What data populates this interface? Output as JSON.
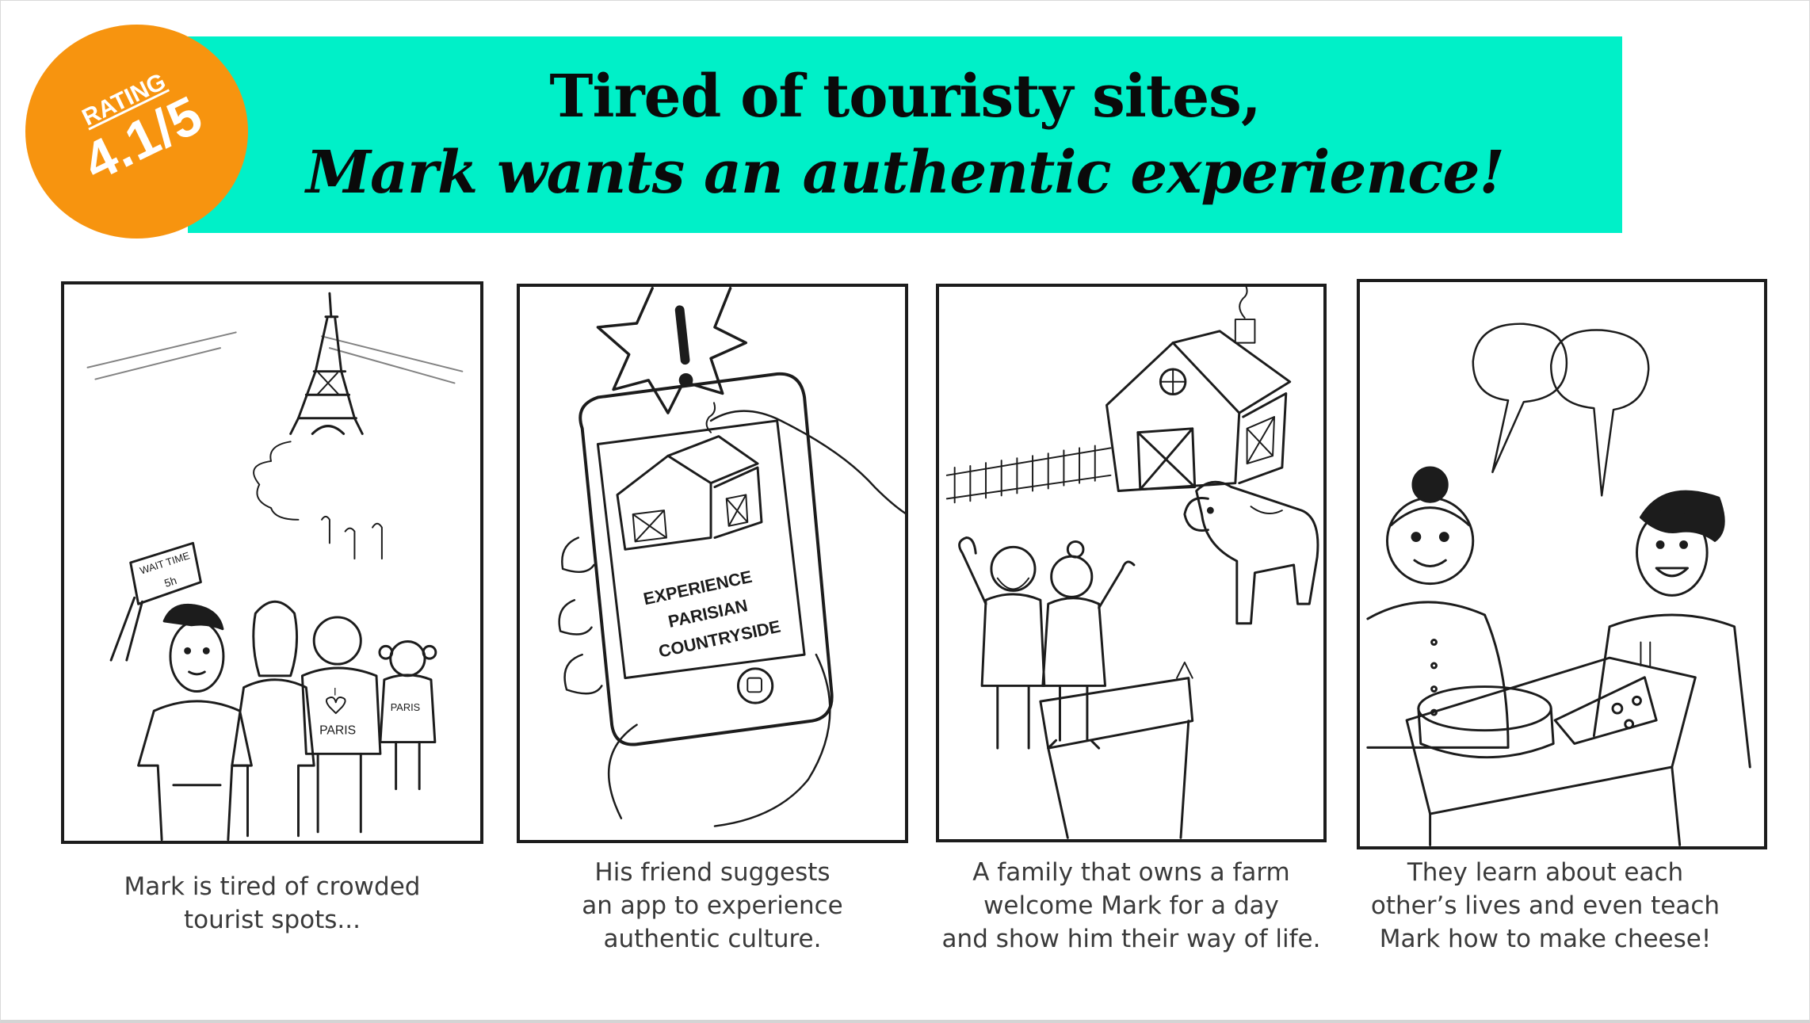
{
  "title": {
    "line1": "Tired of touristy sites,",
    "line2": "Mark wants an authentic experience!"
  },
  "rating": {
    "label": "RATING",
    "value": "4.1/5"
  },
  "panels": [
    {
      "caption": "Mark is tired of crowded\ntourist spots...",
      "sign_label": "WAIT TIME",
      "sign_value": "5h",
      "shirt_text_1": "PARIS",
      "shirt_text_2": "PARIS",
      "heart_text": "I"
    },
    {
      "caption": "His friend suggests\nan app to experience\nauthentic culture.",
      "screen_line1": "EXPERIENCE",
      "screen_line2": "PARISIAN",
      "screen_line3": "COUNTRYSIDE"
    },
    {
      "caption": "A family that owns a farm\nwelcome Mark for a day\nand show him their way of life."
    },
    {
      "caption": "They learn about each\nother’s lives and even teach\nMark how to make cheese!"
    }
  ],
  "colors": {
    "banner": "#00f0c8",
    "badge": "#f7940f",
    "ink": "#1c1c1c",
    "caption": "#3a3a3a"
  }
}
